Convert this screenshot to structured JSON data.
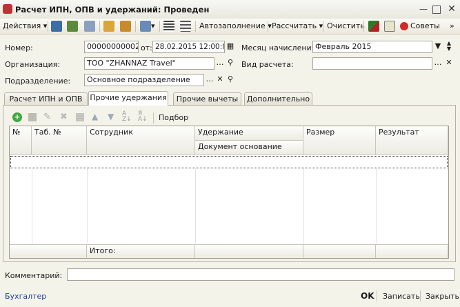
{
  "window": {
    "title": "Расчет ИПН, ОПВ и удержаний: Проведен"
  },
  "toolbar": {
    "actions_label": "Действия",
    "autofill_label": "Автозаполнение",
    "calculate_label": "Рассчитать",
    "clear_label": "Очистить",
    "tips_label": "Советы"
  },
  "form": {
    "number_label": "Номер:",
    "number_value": "00000000002",
    "from_label": "от:",
    "date_value": "28.02.2015 12:00:01",
    "month_label": "Месяц начисления:",
    "month_value": "Февраль 2015",
    "org_label": "Организация:",
    "org_value": "ТОО  \"ZHANNAZ Travel\"",
    "calc_type_label": "Вид расчета:",
    "calc_type_value": "",
    "division_label": "Подразделение:",
    "division_value": "Основное подразделение"
  },
  "tabs": [
    {
      "label": "Расчет ИПН и ОПВ"
    },
    {
      "label": "Прочие удержания"
    },
    {
      "label": "Прочие вычеты"
    },
    {
      "label": "Дополнительно"
    }
  ],
  "grid_toolbar": {
    "select_label": "Подбор"
  },
  "grid": {
    "col_num": "№",
    "col_tab": "Таб. №",
    "col_employee": "Сотрудник",
    "col_deduction": "Удержание",
    "col_base_doc": "Документ основание",
    "col_size": "Размер",
    "col_result": "Результат",
    "total_label": "Итого:"
  },
  "comment": {
    "label": "Комментарий:",
    "value": ""
  },
  "footer": {
    "responsible": "Бухгалтер",
    "ok_label": "OK",
    "save_label": "Записать",
    "close_label": "Закрыть"
  }
}
